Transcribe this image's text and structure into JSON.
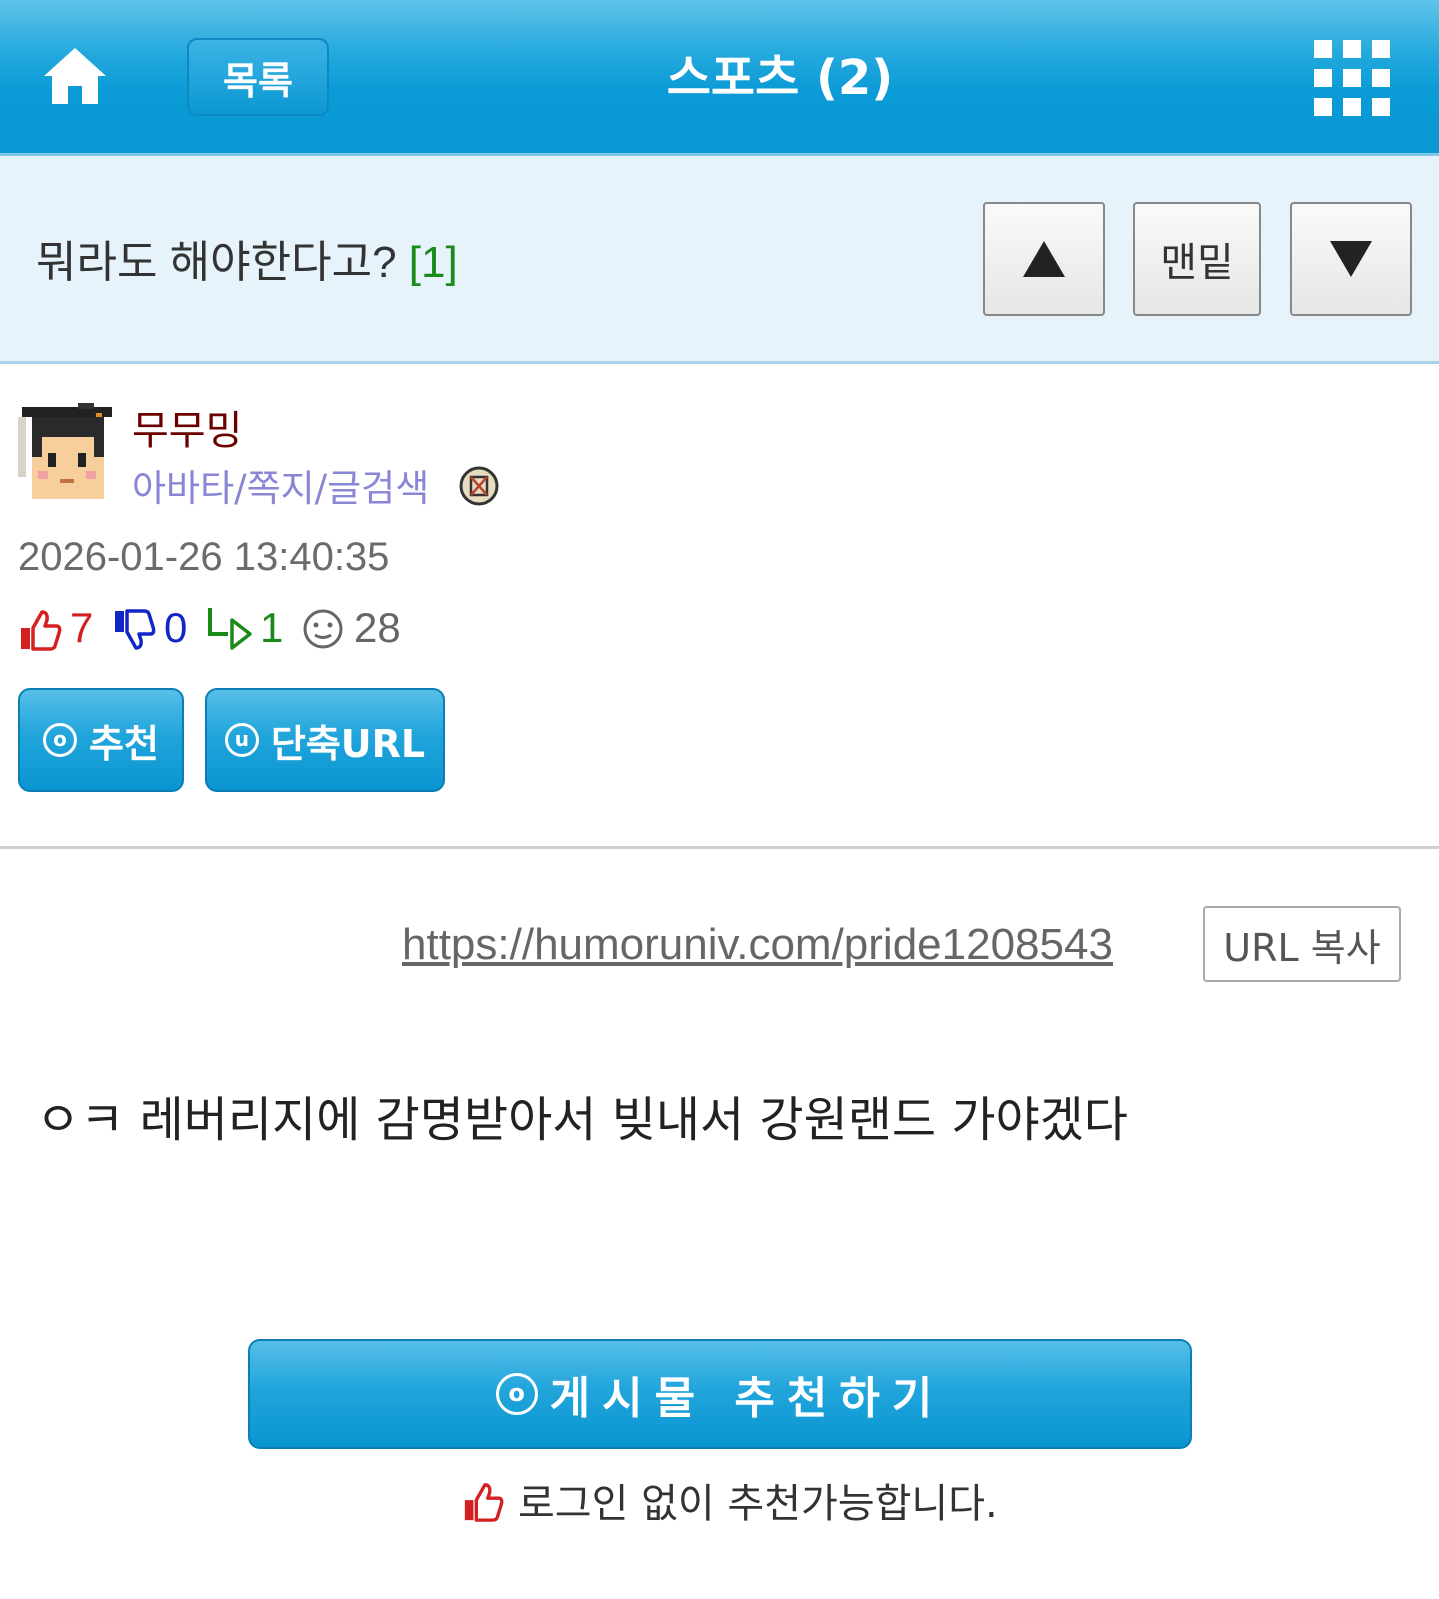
{
  "header": {
    "list_label": "목록",
    "category_title": "스포츠 (2)"
  },
  "post": {
    "title": "뭐라도 해야한다고?",
    "comment_count": "[1]",
    "nav": {
      "up": "▲",
      "bottom": "맨밑",
      "down": "▼"
    },
    "author": "무무밍",
    "author_links": "아바타/쪽지/글검색",
    "datetime": "2026-01-26 13:40:35",
    "stats": {
      "likes": "7",
      "dislikes": "0",
      "replies": "1",
      "views": "28"
    },
    "recommend_label": "추천",
    "recommend_icon_letter": "o",
    "short_url_label": "단축URL",
    "short_url_icon_letter": "u",
    "url": "https://humoruniv.com/pride1208543",
    "copy_url_label": "URL 복사",
    "body": "ㅇㅋ 레버리지에 감명받아서 빚내서 강원랜드 가야겠다",
    "big_recommend_label": "게시물 추천하기",
    "login_note": "로그인 없이 추천가능합니다."
  },
  "colors": {
    "header_blue": "#0a9ad6",
    "title_bar": "#e6f3fa",
    "author": "#6b0000",
    "links": "#8a86d6",
    "like": "#d42020",
    "dislike": "#1226c8",
    "reply": "#1a8a1a"
  }
}
